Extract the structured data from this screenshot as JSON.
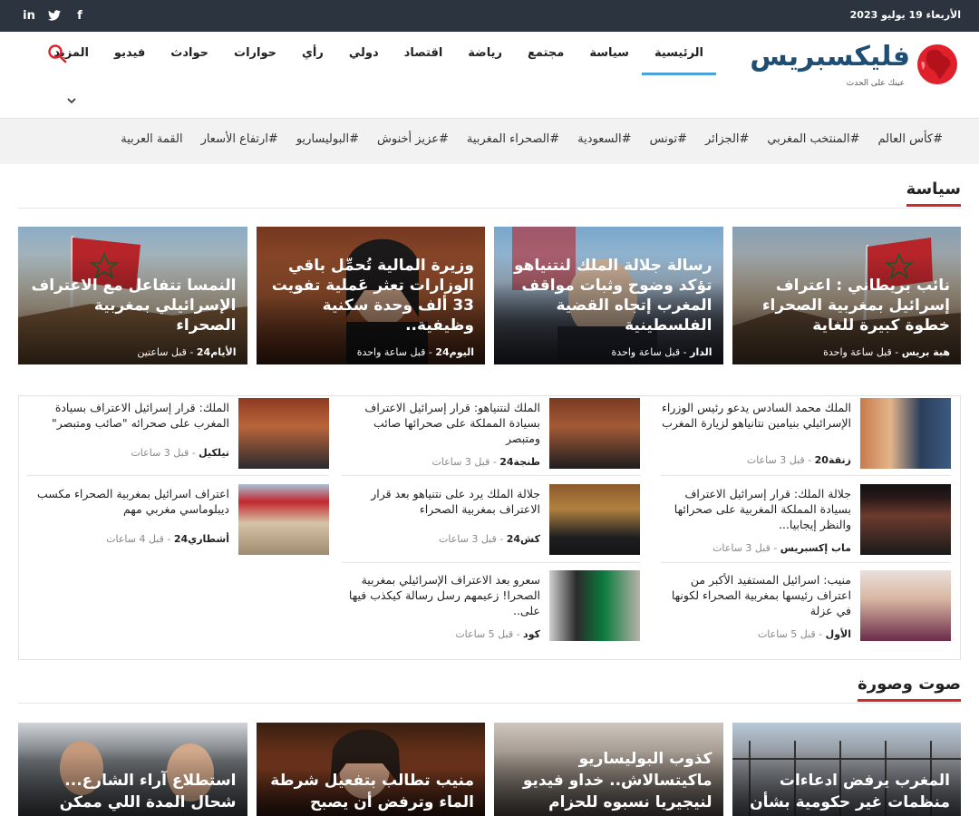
{
  "topbar": {
    "date": "الأربعاء 19 يوليو 2023",
    "social": [
      "linkedin-icon",
      "twitter-icon",
      "facebook-icon"
    ]
  },
  "logo": {
    "name": "فليكسبريس",
    "tagline": "عينك على الحدث",
    "brand_color": "#1f4e75",
    "accent_color": "#e0202a"
  },
  "nav": {
    "items": [
      "الرئيسية",
      "سياسة",
      "مجتمع",
      "رياضة",
      "اقتصاد",
      "دولي",
      "رأي",
      "حوارات",
      "حوادث",
      "فيديو",
      "المزيد"
    ],
    "active": "الرئيسية"
  },
  "tags": [
    "#كأس العالم",
    "#المنتخب المغربي",
    "#الجزائر",
    "#تونس",
    "#السعودية",
    "#الصحراء المغربية",
    "#عزيز أخنوش",
    "#البوليساريو",
    "#ارتفاع الأسعار",
    "القمة العربية"
  ],
  "section_politics": {
    "title": "سياسة",
    "features": [
      {
        "title": "نائب بريطاني : اعتراف إسرائيل بمغربية الصحراء خطوة كبيرة للغاية",
        "source": "هبة بريس",
        "time": "قبل ساعة واحدة"
      },
      {
        "title": "رسالة جلالة الملك لنتنياهو تؤكد وضوح وثبات مواقف المغرب إتجاه القضية الفلسطينية",
        "source": "الدار",
        "time": "قبل ساعة واحدة"
      },
      {
        "title": "وزيرة المالية تُحمِّل باقي الوزارات تعثر عَملية تفويت 33 ألف وحدة سكنية وظيفية..",
        "source": "اليوم24",
        "time": "قبل ساعة واحدة"
      },
      {
        "title": "النمسا تتفاعل مع الاعتراف الإسرائيلي بمغربية الصحراء",
        "source": "الأيام24",
        "time": "قبل ساعتين"
      }
    ],
    "list": [
      {
        "title": "الملك محمد السادس يدعو رئيس الوزراء الإسرائيلي بنيامين نتانياهو لزيارة المغرب",
        "source": "زنقة20",
        "time": "قبل 3 ساعات"
      },
      {
        "title": "جلالة الملك: قرار إسرائيل الاعتراف بسيادة المملكة المغربية على صحرائها والنظر إيجابيا...",
        "source": "ماب إكسبريس",
        "time": "قبل 3 ساعات"
      },
      {
        "title": "منيب: اسرائيل المستفيد الأكبر من اعتراف رئيسها بمغربية الصحراء لكونها في عزلة",
        "source": "الأول",
        "time": "قبل 5 ساعات"
      },
      {
        "title": "الملك لنتنياهو: قرار إسرائيل الاعتراف بسيادة المملكة على صحرائها صائب ومتبصر",
        "source": "طنجة24",
        "time": "قبل 3 ساعات"
      },
      {
        "title": "جلالة الملك يرد على نتنياهو بعد قرار الاعتراف بمغربية الصحراء",
        "source": "كش24",
        "time": "قبل 3 ساعات"
      },
      {
        "title": "سعرو بعد الاعتراف الإسرائيلي بمغربية الصحرا! زعيمهم رسل رسالة كيكذب فيها على..",
        "source": "كود",
        "time": "قبل 5 ساعات"
      },
      {
        "title": "الملك: قرار إسرائيل الاعتراف بسيادة المغرب على صحرائه \"صائب ومتبصر\"",
        "source": "تيلكيل",
        "time": "قبل 3 ساعات"
      },
      {
        "title": "اعتراف اسرائيل بمغربية الصحراء مكسب ديبلوماسي مغربي مهم",
        "source": "أشطاري24",
        "time": "قبل 4 ساعات"
      }
    ]
  },
  "section_media": {
    "title": "صوت وصورة",
    "features": [
      {
        "title": "المغرب يرفض ادعاءات منظمات غير حكومية بشأن تدبير قضايا"
      },
      {
        "title": "كذوب البوليساريو ماكيتسالاش.. خداو فيديو لنيجيريا نسبوه للحزام الناقل"
      },
      {
        "title": "منيب تطالب بتفعيل شرطة الماء وترفض أن يصبح المغرب"
      },
      {
        "title": "استطلاع آراء الشارع... شحال المدة اللي ممكن تستحمل"
      }
    ]
  }
}
